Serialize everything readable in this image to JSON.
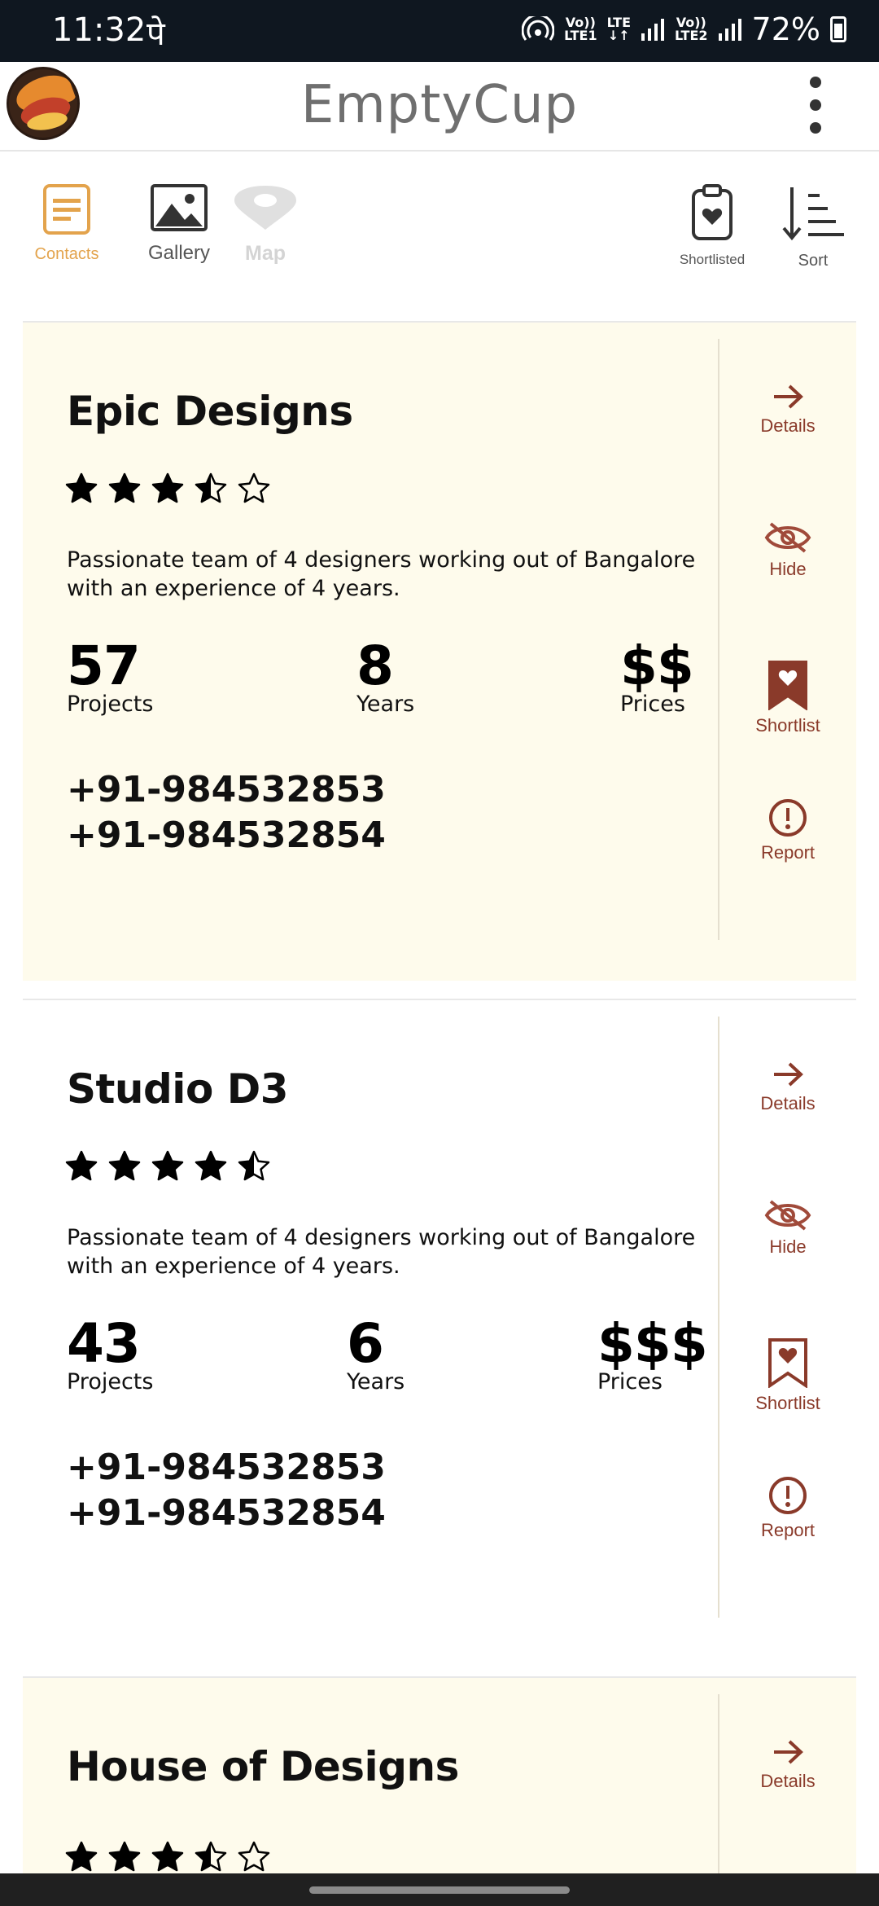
{
  "status_bar": {
    "time": "11:32",
    "carrier_glyph": "पे",
    "net1_top": "Vo))",
    "net1_bottom": "LTE1",
    "lte": "LTE",
    "net2_top": "Vo))",
    "net2_bottom": "LTE2",
    "battery": "72%"
  },
  "app": {
    "title": "EmptyCup",
    "logo_icon": "emptycup-logo",
    "menu_icon": "more-vertical-icon"
  },
  "toolbar": {
    "contacts_label": "Contacts",
    "gallery_label": "Gallery",
    "map_label": "Map",
    "shortlisted_label": "Shortlisted",
    "sort_label": "Sort",
    "active_color": "#e3a34c"
  },
  "actions": {
    "details": "Details",
    "hide": "Hide",
    "shortlist": "Shortlist",
    "report": "Report",
    "color": "#8a3a2a"
  },
  "cards": [
    {
      "name": "Epic Designs",
      "rating": 3.5,
      "description": "Passionate team of 4 designers working out of Bangalore with an experience of 4 years.",
      "projects": "57",
      "projects_label": "Projects",
      "years": "8",
      "years_label": "Years",
      "prices": "$$",
      "prices_label": "Prices",
      "phone1": "+91-984532853",
      "phone2": "+91-984532854",
      "shortlisted": true
    },
    {
      "name": "Studio D3",
      "rating": 4.5,
      "description": "Passionate team of 4 designers working out of Bangalore with an experience of 4 years.",
      "projects": "43",
      "projects_label": "Projects",
      "years": "6",
      "years_label": "Years",
      "prices": "$$$",
      "prices_label": "Prices",
      "phone1": "+91-984532853",
      "phone2": "+91-984532854",
      "shortlisted": false
    },
    {
      "name": "House of Designs",
      "rating": 3.5
    }
  ]
}
